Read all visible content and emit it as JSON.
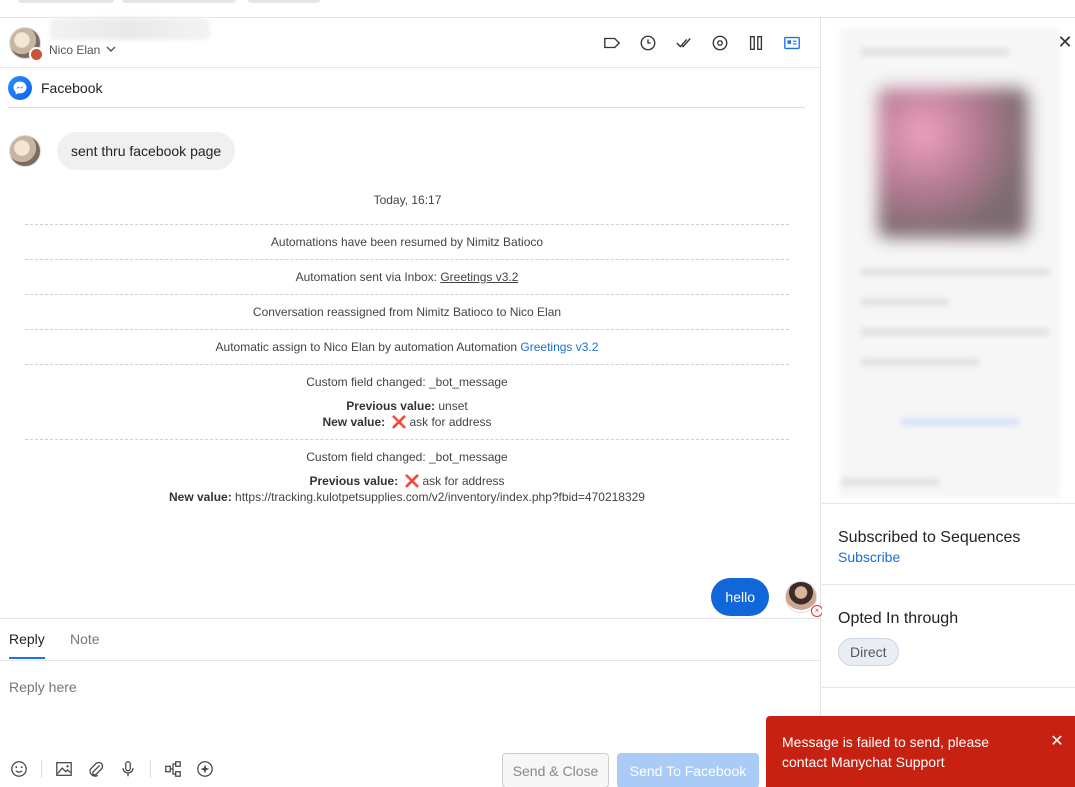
{
  "header": {
    "assignee_name": "Nico Elan"
  },
  "channel": {
    "name": "Facebook"
  },
  "thread": {
    "incoming_message": "sent thru facebook page",
    "timestamp": "Today, 16:17",
    "events": {
      "resumed": "Automations have been resumed by Nimitz Batioco",
      "sent_prefix": "Automation sent via Inbox: ",
      "sent_link": "Greetings v3.2",
      "reassigned": "Conversation reassigned from Nimitz Batioco to Nico Elan",
      "assign_prefix": "Automatic assign to Nico Elan by automation Automation ",
      "assign_link": "Greetings v3.2",
      "cf1_title": "Custom field changed: _bot_message",
      "cf1_prev_label": "Previous value:",
      "cf1_prev_value": "unset",
      "cf1_new_label": "New value:",
      "cf1_new_value": "ask for address",
      "cf2_title": "Custom field changed: _bot_message",
      "cf2_prev_label": "Previous value:",
      "cf2_prev_value": "ask for address",
      "cf2_new_label": "New value:",
      "cf2_new_value": "https://tracking.kulotpetsupplies.com/v2/inventory/index.php?fbid=470218329"
    },
    "x_mark": "❌",
    "outgoing_message": "hello"
  },
  "composer": {
    "tab_reply": "Reply",
    "tab_note": "Note",
    "placeholder": "Reply here",
    "send_close_label": "Send & Close",
    "send_label": "Send To Facebook"
  },
  "sidebar": {
    "close_glyph": "✕",
    "sequences_title": "Subscribed to Sequences",
    "sequences_link": "Subscribe",
    "opted_title": "Opted In through",
    "opted_chip": "Direct"
  },
  "toast": {
    "message": "Message is failed to send, please contact Manychat Support",
    "close_glyph": "✕"
  },
  "colors": {
    "accent": "#1067d9",
    "error": "#c62111",
    "link": "#1a6fd6"
  }
}
